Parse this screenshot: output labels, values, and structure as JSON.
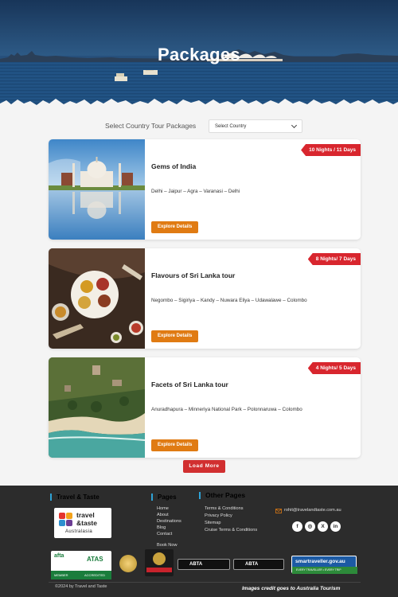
{
  "hero": {
    "title": "Packages"
  },
  "filter": {
    "label": "Select Country Tour Packages",
    "select_value": "Select Country"
  },
  "packages": [
    {
      "badge": "10 Nights / 11 Days",
      "title": "Gems of India",
      "route": "Delhi – Jaipur – Agra – Varanasi – Delhi",
      "button": "Explore Details"
    },
    {
      "badge": "8 Nights/ 7 Days",
      "title": "Flavours of Sri Lanka tour",
      "route": "Negombo – Sigiriya – Kandy – Nuwara Eliya – Udawalawe – Colombo",
      "button": "Explore Details"
    },
    {
      "badge": "4 Nights/ 5 Days",
      "title": "Facets of Sri Lanka tour",
      "route": "Anuradhapura – Minneriya National Park – Polonnaruwa – Colombo",
      "button": "Explore Details"
    }
  ],
  "load_more": "Load More",
  "footer": {
    "col1_title": "Travel & Taste",
    "logo": {
      "line1": "travel",
      "line2": "&taste",
      "line3": "Australasia"
    },
    "col2_title": "Pages",
    "pages": [
      "Home",
      "About",
      "Destinations",
      "Blog",
      "Contact",
      "",
      "Book Now"
    ],
    "col3_title": "Other Pages",
    "other_pages": [
      "Terms & Conditions",
      "Privacy Policy",
      "Sitemap",
      "Cruise Terms & Conditions"
    ],
    "email": "rohit@travelandtaste.com.au",
    "socials": [
      "facebook-icon",
      "instagram-icon",
      "x-icon",
      "linkedin-icon"
    ],
    "social_glyphs": [
      "f",
      "◎",
      "X",
      "in"
    ],
    "afta": {
      "top": "afta",
      "right": "ATAS",
      "member": "MEMBER",
      "accredited": "ACCREDITED"
    },
    "abta1": "ABTA",
    "abta2": "ABTA",
    "smartraveller": {
      "main": "smartraveller.gov.au",
      "sub": "EVERY TRAVELLER • EVERY TRIP"
    },
    "copyright": "©2024 by Travel and Taste",
    "credit": "Images credit goes to Australia Tourism"
  },
  "colors": {
    "badge": "#d8262e",
    "button": "#e07b13",
    "load_more": "#d12f30",
    "footer_bg": "#2c2c2c",
    "accent": "#2ea3d6"
  }
}
